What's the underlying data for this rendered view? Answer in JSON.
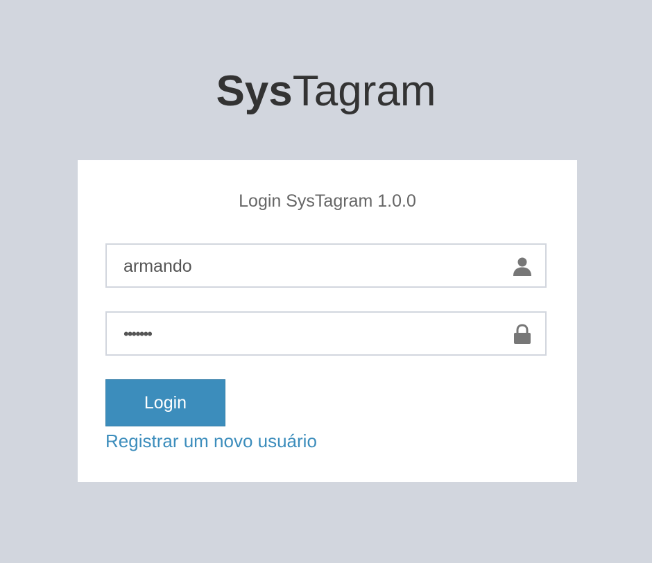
{
  "logo": {
    "bold_part": "Sys",
    "light_part": "Tagram"
  },
  "login_box": {
    "title": "Login SysTagram 1.0.0",
    "username": {
      "value": "armando",
      "icon": "user-icon"
    },
    "password": {
      "value": "•••••••",
      "icon": "lock-icon"
    },
    "submit_label": "Login",
    "register_link": "Registrar um novo usuário"
  },
  "colors": {
    "background": "#d2d6de",
    "card": "#ffffff",
    "accent": "#3c8dbc",
    "text": "#333333",
    "icon": "#777777"
  }
}
